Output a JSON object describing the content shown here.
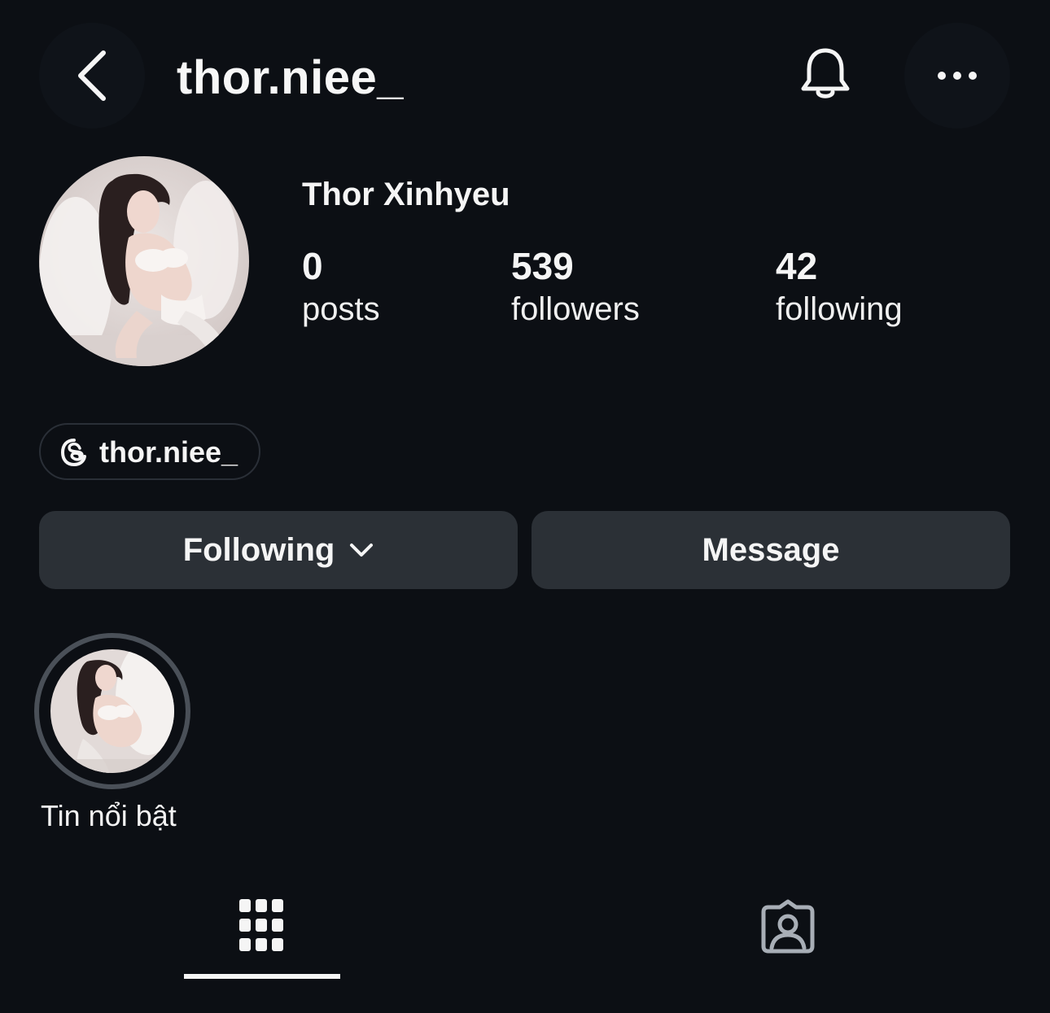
{
  "header": {
    "username": "thor.niee_",
    "back_icon": "chevron-left-icon",
    "notification_icon": "bell-icon",
    "more_icon": "more-horizontal-icon"
  },
  "profile": {
    "display_name": "Thor Xinhyeu",
    "avatar_alt": "profile-photo",
    "stats": [
      {
        "value": "0",
        "label": "posts"
      },
      {
        "value": "539",
        "label": "followers"
      },
      {
        "value": "42",
        "label": "following"
      }
    ],
    "threads_handle": "thor.niee_"
  },
  "actions": {
    "following_label": "Following",
    "message_label": "Message"
  },
  "highlights": [
    {
      "label": "Tin nổi bật"
    }
  ],
  "tabs": [
    {
      "name": "grid",
      "icon": "grid-icon",
      "active": true
    },
    {
      "name": "tagged",
      "icon": "tagged-person-icon",
      "active": false
    }
  ],
  "colors": {
    "background": "#0c0f14",
    "button_bg": "#2b3036",
    "text": "#f5f5f5",
    "ring": "#4a5058"
  }
}
